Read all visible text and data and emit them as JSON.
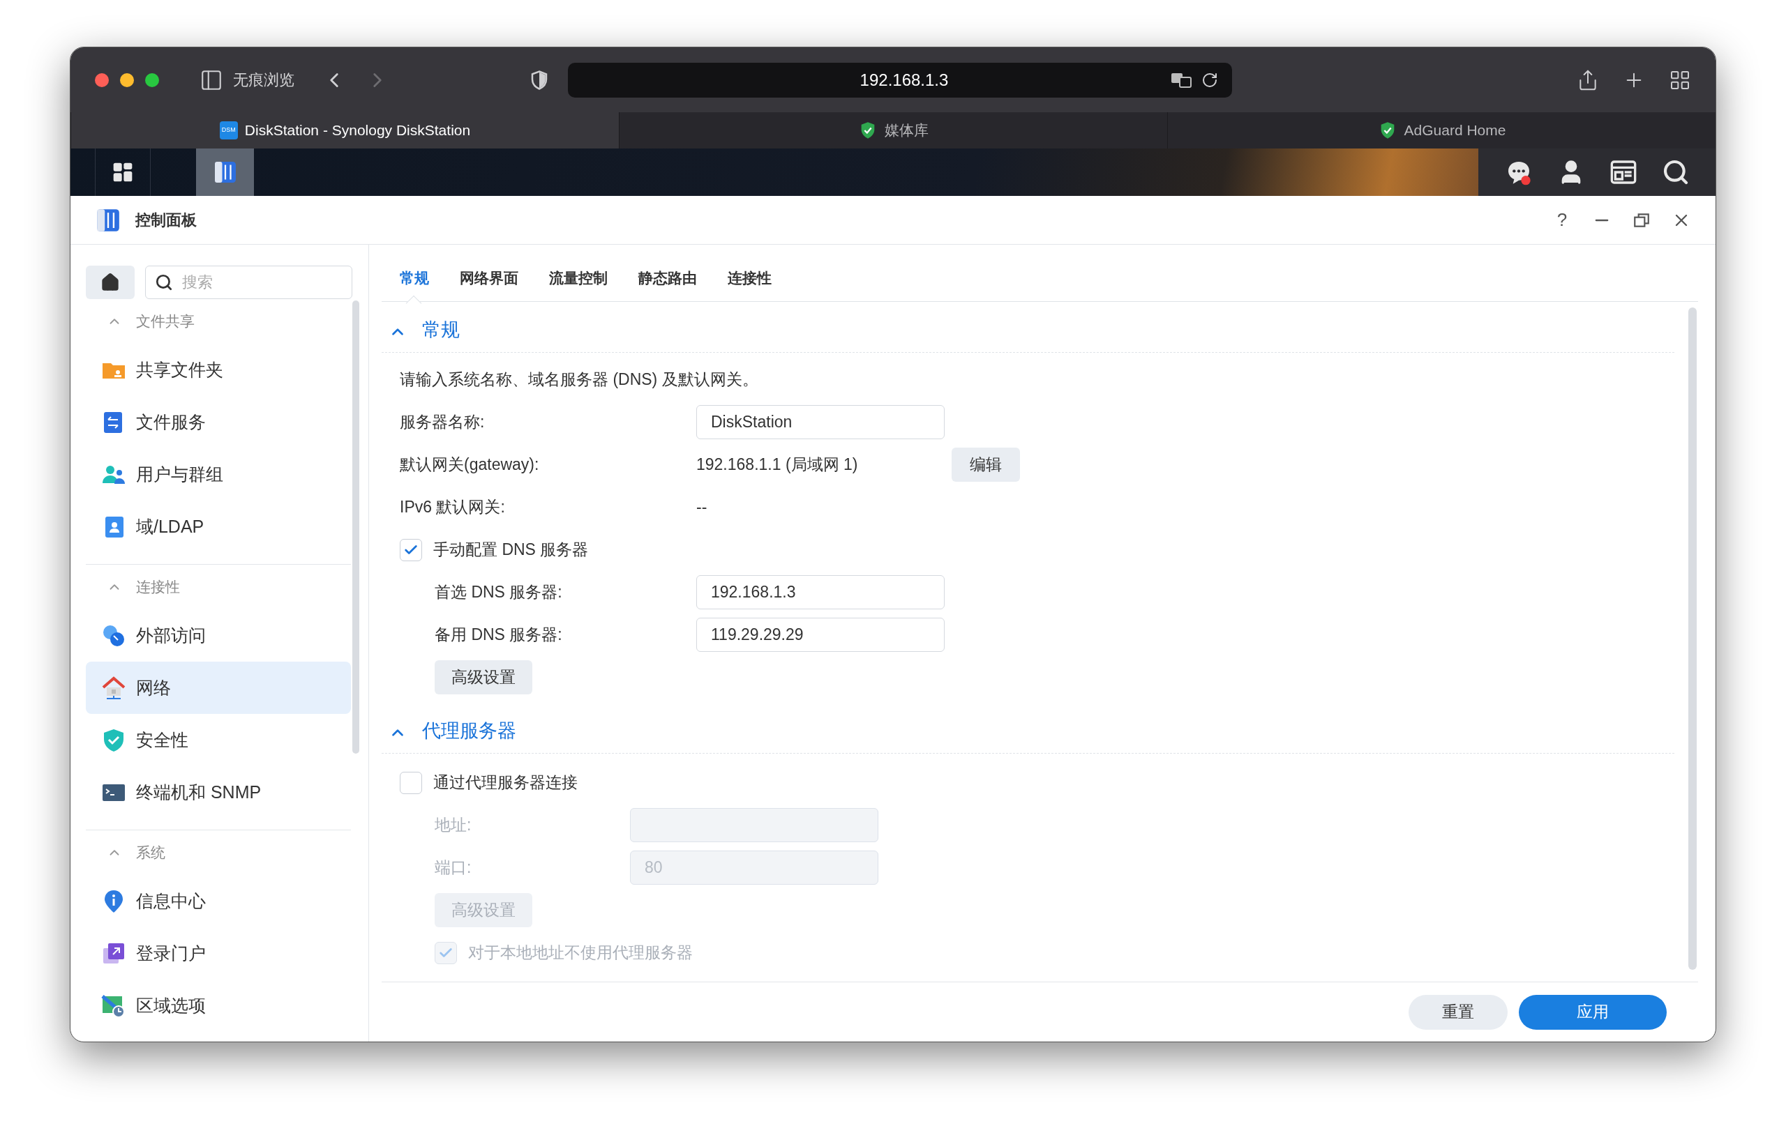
{
  "browser": {
    "private_label": "无痕浏览",
    "url": "192.168.1.3",
    "tabs": [
      {
        "label": "DiskStation - Synology DiskStation",
        "favicon": "DSM",
        "selected": true
      },
      {
        "label": "媒体库",
        "selected": false
      },
      {
        "label": "AdGuard Home",
        "selected": false
      }
    ]
  },
  "window": {
    "title": "控制面板",
    "help": "?"
  },
  "sidebar": {
    "search": {
      "placeholder": "搜索"
    },
    "sections": [
      {
        "title": "文件共享",
        "expanded": true,
        "items": [
          {
            "label": "共享文件夹",
            "selected": false
          },
          {
            "label": "文件服务",
            "selected": false
          },
          {
            "label": "用户与群组",
            "selected": false
          },
          {
            "label": "域/LDAP",
            "selected": false
          }
        ]
      },
      {
        "title": "连接性",
        "expanded": true,
        "items": [
          {
            "label": "外部访问",
            "selected": false
          },
          {
            "label": "网络",
            "selected": true
          },
          {
            "label": "安全性",
            "selected": false
          },
          {
            "label": "终端机和 SNMP",
            "selected": false
          }
        ]
      },
      {
        "title": "系统",
        "expanded": true,
        "items": [
          {
            "label": "信息中心",
            "selected": false
          },
          {
            "label": "登录门户",
            "selected": false
          },
          {
            "label": "区域选项",
            "selected": false
          }
        ]
      }
    ]
  },
  "tabs": [
    {
      "label": "常规",
      "selected": true
    },
    {
      "label": "网络界面",
      "selected": false
    },
    {
      "label": "流量控制",
      "selected": false
    },
    {
      "label": "静态路由",
      "selected": false
    },
    {
      "label": "连接性",
      "selected": false
    }
  ],
  "sections": [
    {
      "title": "常规",
      "expanded": true,
      "rows": [
        {
          "kind": "description",
          "text": "请输入系统名称、域名服务器 (DNS) 及默认网关。"
        },
        {
          "kind": "input",
          "label": "服务器名称:",
          "value": "DiskStation",
          "indented": false,
          "disabled": false
        },
        {
          "kind": "value",
          "label": "默认网关(gateway):",
          "value": "192.168.1.1 (局域网 1)",
          "button": "编辑",
          "indented": false
        },
        {
          "kind": "value",
          "label": "IPv6 默认网关:",
          "value": "--",
          "indented": false
        },
        {
          "kind": "checkbox",
          "label": "手动配置 DNS 服务器",
          "checked": true,
          "disabled": false
        },
        {
          "kind": "input",
          "label": "首选 DNS 服务器:",
          "value": "192.168.1.3",
          "indented": true,
          "disabled": false
        },
        {
          "kind": "input",
          "label": "备用 DNS 服务器:",
          "value": "119.29.29.29",
          "indented": true,
          "disabled": false
        },
        {
          "kind": "button",
          "label": "高级设置",
          "disabled": false
        }
      ]
    },
    {
      "title": "代理服务器",
      "expanded": true,
      "rows": [
        {
          "kind": "checkbox",
          "label": "通过代理服务器连接",
          "checked": false,
          "disabled": false
        },
        {
          "kind": "input",
          "label": "地址:",
          "indented": true,
          "disabled": true
        },
        {
          "kind": "input",
          "label": "端口:",
          "value": "80",
          "indented": true,
          "disabled": true
        },
        {
          "kind": "button",
          "label": "高级设置",
          "disabled": true
        },
        {
          "kind": "checkbox",
          "label": "对于本地地址不使用代理服务器",
          "checked": true,
          "disabled": true,
          "indented": true
        }
      ]
    }
  ],
  "footer": {
    "buttons": [
      {
        "label": "重置",
        "kind": "secondary"
      },
      {
        "label": "应用",
        "kind": "primary"
      }
    ]
  }
}
